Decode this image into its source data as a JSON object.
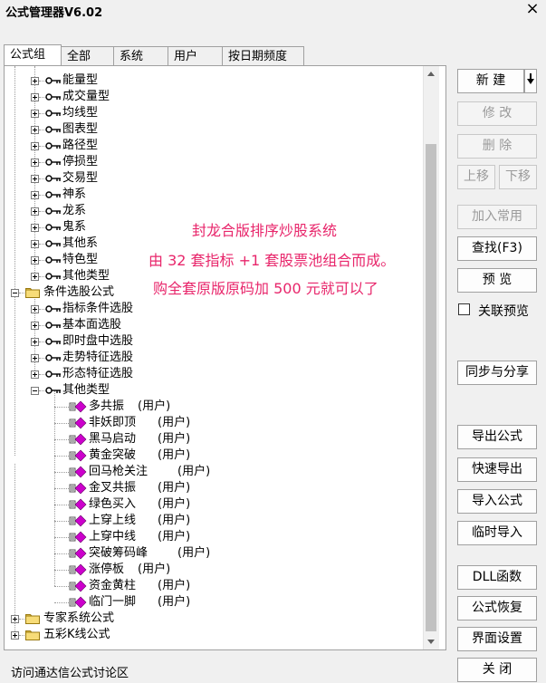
{
  "window": {
    "title": "公式管理器V6.02"
  },
  "tabs": [
    {
      "label": "公式组",
      "active": true
    },
    {
      "label": "全部",
      "active": false
    },
    {
      "label": "系统",
      "active": false
    },
    {
      "label": "用户",
      "active": false
    },
    {
      "label": "按日期频度",
      "active": false
    }
  ],
  "tree": {
    "level1_items": [
      "能量型",
      "成交量型",
      "均线型",
      "图表型",
      "路径型",
      "停损型",
      "交易型",
      "神系",
      "龙系",
      "鬼系",
      "其他系",
      "特色型",
      "其他类型"
    ],
    "condition_group": "条件选股公式",
    "condition_items": [
      "指标条件选股",
      "基本面选股",
      "即时盘中选股",
      "走势特征选股",
      "形态特征选股",
      "其他类型"
    ],
    "other_type_children": [
      {
        "name": "多共振",
        "tag": "(用户)"
      },
      {
        "name": "非妖即顶",
        "tag": "(用户)"
      },
      {
        "name": "黑马启动",
        "tag": "(用户)"
      },
      {
        "name": "黄金突破",
        "tag": "(用户)"
      },
      {
        "name": "回马枪关注",
        "tag": "(用户)"
      },
      {
        "name": "金叉共振",
        "tag": "(用户)"
      },
      {
        "name": "绿色买入",
        "tag": "(用户)"
      },
      {
        "name": "上穿上线",
        "tag": "(用户)"
      },
      {
        "name": "上穿中线",
        "tag": "(用户)"
      },
      {
        "name": "突破筹码峰",
        "tag": "(用户)"
      },
      {
        "name": "涨停板",
        "tag": "(用户)"
      },
      {
        "name": "资金黄柱",
        "tag": "(用户)"
      },
      {
        "name": "临门一脚",
        "tag": "(用户)"
      }
    ],
    "bottom_groups": [
      "专家系统公式",
      "五彩K线公式"
    ]
  },
  "overlay": {
    "line1": "封龙合版排序炒股系统",
    "line2": "由 32 套指标 +1 套股票池组合而成。",
    "line3": "购全套原版原码加 500 元就可以了"
  },
  "buttons": {
    "new": "新 建",
    "modify": "修 改",
    "delete": "删 除",
    "move_up": "上移",
    "move_down": "下移",
    "add_common": "加入常用",
    "find": "查找(F3)",
    "preview": "预 览",
    "linked_preview": "关联预览",
    "sync_share": "同步与分享",
    "export": "导出公式",
    "quick_export": "快速导出",
    "import": "导入公式",
    "temp_import": "临时导入",
    "dll": "DLL函数",
    "restore": "公式恢复",
    "ui_settings": "界面设置",
    "close": "关 闭"
  },
  "status": {
    "link": "访问通达信公式讨论区"
  },
  "colors": {
    "overlay_text": "#e8266b",
    "formula_icon": "#cc00cc"
  }
}
